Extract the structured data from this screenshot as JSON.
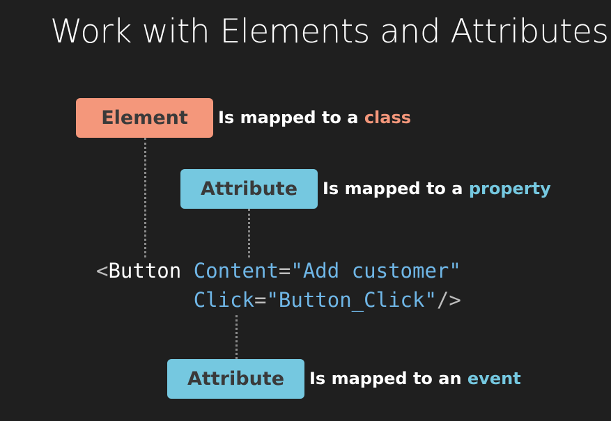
{
  "title": "Work with Elements and Attributes",
  "element_box": {
    "label": "Element",
    "desc_prefix": "Is mapped to a ",
    "desc_accent": "class"
  },
  "attribute_box_1": {
    "label": "Attribute",
    "desc_prefix": "Is mapped to a ",
    "desc_accent": "property"
  },
  "attribute_box_2": {
    "label": "Attribute",
    "desc_prefix": "Is mapped to an ",
    "desc_accent": "event"
  },
  "code": {
    "line1": {
      "open": "<",
      "tag": "Button",
      "space": " ",
      "attr": "Content",
      "eq": "=",
      "value": "\"Add customer\""
    },
    "line2": {
      "indent": "        ",
      "attr": "Click",
      "eq": "=",
      "value": "\"Button_Click\"",
      "close": "/>"
    }
  },
  "colors": {
    "background": "#1f1f1f",
    "element_accent": "#f4977b",
    "attribute_accent": "#75c8e0",
    "code_attr": "#6fb6e6"
  }
}
